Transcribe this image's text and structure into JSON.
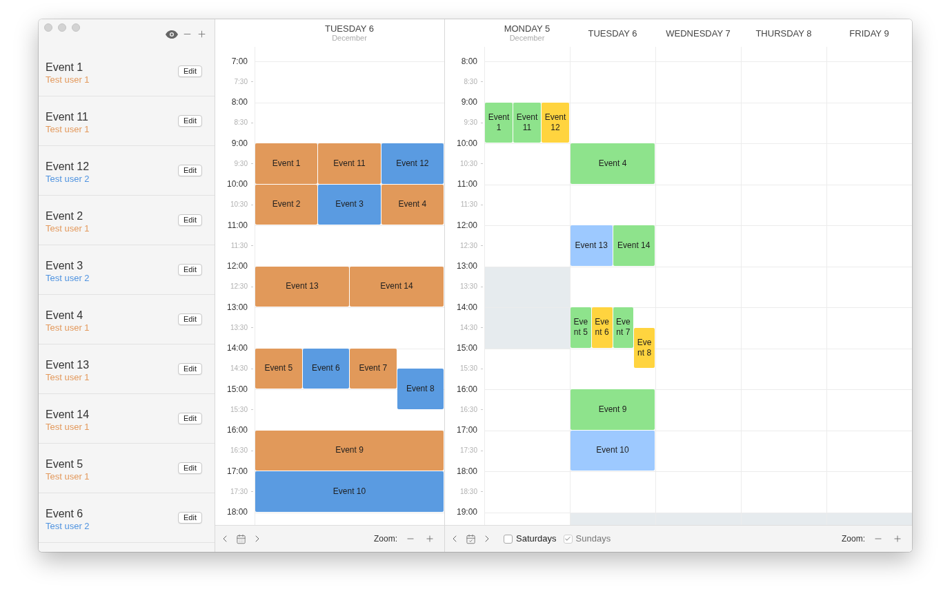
{
  "sidebar": {
    "items": [
      {
        "title": "Event 1",
        "user": "Test user 1",
        "color": "#e3995c",
        "button": "Edit"
      },
      {
        "title": "Event 11",
        "user": "Test user 1",
        "color": "#e3995c",
        "button": "Edit"
      },
      {
        "title": "Event 12",
        "user": "Test user 2",
        "color": "#4f93e0",
        "button": "Edit"
      },
      {
        "title": "Event 2",
        "user": "Test user 1",
        "color": "#e3995c",
        "button": "Edit"
      },
      {
        "title": "Event 3",
        "user": "Test user 2",
        "color": "#4f93e0",
        "button": "Edit"
      },
      {
        "title": "Event 4",
        "user": "Test user 1",
        "color": "#e3995c",
        "button": "Edit"
      },
      {
        "title": "Event 13",
        "user": "Test user 1",
        "color": "#e3995c",
        "button": "Edit"
      },
      {
        "title": "Event 14",
        "user": "Test user 1",
        "color": "#e3995c",
        "button": "Edit"
      },
      {
        "title": "Event 5",
        "user": "Test user 1",
        "color": "#e3995c",
        "button": "Edit"
      },
      {
        "title": "Event 6",
        "user": "Test user 2",
        "color": "#4f93e0",
        "button": "Edit"
      }
    ]
  },
  "day_view": {
    "title": "TUESDAY 6",
    "month": "December",
    "slots": [
      {
        "label": "7:00",
        "kind": "hour"
      },
      {
        "label": "7:30",
        "kind": "half"
      },
      {
        "label": "8:00",
        "kind": "hour"
      },
      {
        "label": "8:30",
        "kind": "half"
      },
      {
        "label": "9:00",
        "kind": "hour",
        "events": [
          {
            "title": "Event 1",
            "color": "#e1995a"
          },
          {
            "title": "Event 11",
            "color": "#e1995a"
          },
          {
            "title": "Event 12",
            "color": "#5a9be1"
          }
        ]
      },
      {
        "label": "9:30",
        "kind": "half"
      },
      {
        "label": "10:00",
        "kind": "hour",
        "events": [
          {
            "title": "Event 2",
            "color": "#e1995a"
          },
          {
            "title": "Event 3",
            "color": "#5a9be1"
          },
          {
            "title": "Event 4",
            "color": "#e1995a"
          }
        ]
      },
      {
        "label": "10:30",
        "kind": "half"
      },
      {
        "label": "11:00",
        "kind": "hour"
      },
      {
        "label": "11:30",
        "kind": "half"
      },
      {
        "label": "12:00",
        "kind": "hour",
        "events": [
          {
            "title": "Event 13",
            "color": "#e1995a"
          },
          {
            "title": "Event 14",
            "color": "#e1995a"
          }
        ]
      },
      {
        "label": "12:30",
        "kind": "half"
      },
      {
        "label": "13:00",
        "kind": "hour"
      },
      {
        "label": "13:30",
        "kind": "half"
      },
      {
        "label": "14:00",
        "kind": "hour",
        "events": [
          {
            "title": "Event 5",
            "color": "#e1995a"
          },
          {
            "title": "Event 6",
            "color": "#5a9be1"
          },
          {
            "title": "Event 7",
            "color": "#e1995a"
          }
        ]
      },
      {
        "label": "14:30",
        "kind": "half",
        "events": [
          {
            "title": "Event 8",
            "color": "#5a9be1"
          }
        ]
      },
      {
        "label": "15:00",
        "kind": "hour"
      },
      {
        "label": "15:30",
        "kind": "half"
      },
      {
        "label": "16:00",
        "kind": "hour",
        "events": [
          {
            "title": "Event 9",
            "color": "#e1995a"
          }
        ]
      },
      {
        "label": "16:30",
        "kind": "half"
      },
      {
        "label": "17:00",
        "kind": "hour",
        "events": [
          {
            "title": "Event 10",
            "color": "#5a9be1"
          }
        ]
      },
      {
        "label": "17:30",
        "kind": "half"
      },
      {
        "label": "18:00",
        "kind": "hour"
      }
    ],
    "toolbar": {
      "zoom_label": "Zoom:"
    }
  },
  "week_view": {
    "days": [
      {
        "title": "MONDAY 5",
        "month": "December"
      },
      {
        "title": "TUESDAY 6"
      },
      {
        "title": "WEDNESDAY 7"
      },
      {
        "title": "THURSDAY 8"
      },
      {
        "title": "FRIDAY 9"
      }
    ],
    "rows": [
      {
        "label": "8:00",
        "kind": "hour",
        "cells": [
          {
            "kind": "free"
          },
          {
            "kind": "free"
          },
          {
            "kind": "free"
          },
          {
            "kind": "free"
          },
          {
            "kind": "free"
          }
        ]
      },
      {
        "label": "8:30",
        "kind": "half",
        "cells": [
          {
            "kind": "free"
          },
          {
            "kind": "free"
          },
          {
            "kind": "free"
          },
          {
            "kind": "free"
          },
          {
            "kind": "free"
          }
        ]
      },
      {
        "label": "9:00",
        "kind": "hour",
        "cells": [
          {
            "kind": "free",
            "events": [
              {
                "title": "Event 1",
                "color": "#8ee38c"
              },
              {
                "title": "Event 11",
                "color": "#8ee38c"
              },
              {
                "title": "Event 12",
                "color": "#ffd43f"
              }
            ]
          },
          {
            "kind": "free"
          },
          {
            "kind": "free"
          },
          {
            "kind": "free"
          },
          {
            "kind": "free"
          }
        ]
      },
      {
        "label": "9:30",
        "kind": "half",
        "cells": [
          {
            "kind": "free"
          },
          {
            "kind": "free"
          },
          {
            "kind": "free"
          },
          {
            "kind": "free"
          },
          {
            "kind": "free"
          }
        ]
      },
      {
        "label": "10:00",
        "kind": "hour",
        "cells": [
          {
            "kind": "free"
          },
          {
            "kind": "free",
            "events": [
              {
                "title": "Event 4",
                "color": "#8ee38c"
              }
            ]
          },
          {
            "kind": "free"
          },
          {
            "kind": "free"
          },
          {
            "kind": "free"
          }
        ]
      },
      {
        "label": "10:30",
        "kind": "half",
        "cells": [
          {
            "kind": "free"
          },
          {
            "kind": "free"
          },
          {
            "kind": "free"
          },
          {
            "kind": "free"
          },
          {
            "kind": "free"
          }
        ]
      },
      {
        "label": "11:00",
        "kind": "hour",
        "cells": [
          {
            "kind": "free"
          },
          {
            "kind": "free"
          },
          {
            "kind": "free"
          },
          {
            "kind": "free"
          },
          {
            "kind": "free"
          }
        ]
      },
      {
        "label": "11:30",
        "kind": "half",
        "cells": [
          {
            "kind": "free"
          },
          {
            "kind": "free"
          },
          {
            "kind": "free"
          },
          {
            "kind": "free"
          },
          {
            "kind": "free"
          }
        ]
      },
      {
        "label": "12:00",
        "kind": "hour",
        "cells": [
          {
            "kind": "free"
          },
          {
            "kind": "free",
            "events": [
              {
                "title": "Event 13",
                "color": "#9dc9ff"
              },
              {
                "title": "Event 14",
                "color": "#8ee38c"
              }
            ]
          },
          {
            "kind": "free"
          },
          {
            "kind": "free"
          },
          {
            "kind": "free"
          }
        ]
      },
      {
        "label": "12:30",
        "kind": "half",
        "cells": [
          {
            "kind": "free"
          },
          {
            "kind": "free"
          },
          {
            "kind": "free"
          },
          {
            "kind": "free"
          },
          {
            "kind": "free"
          }
        ]
      },
      {
        "label": "13:00",
        "kind": "hour",
        "cells": [
          {
            "kind": "unavailable"
          },
          {
            "kind": "free"
          },
          {
            "kind": "free"
          },
          {
            "kind": "free"
          },
          {
            "kind": "free"
          }
        ]
      },
      {
        "label": "13:30",
        "kind": "half",
        "cells": [
          {
            "kind": "unavailable"
          },
          {
            "kind": "free"
          },
          {
            "kind": "free"
          },
          {
            "kind": "free"
          },
          {
            "kind": "free"
          }
        ]
      },
      {
        "label": "14:00",
        "kind": "hour",
        "cells": [
          {
            "kind": "unavailable"
          },
          {
            "kind": "free",
            "events": [
              {
                "title": "Event 5",
                "color": "#8ee38c"
              },
              {
                "title": "Event 6",
                "color": "#ffd43f"
              },
              {
                "title": "Event 7",
                "color": "#8ee38c"
              }
            ]
          },
          {
            "kind": "free"
          },
          {
            "kind": "free"
          },
          {
            "kind": "free"
          }
        ]
      },
      {
        "label": "14:30",
        "kind": "half",
        "cells": [
          {
            "kind": "unavailable"
          },
          {
            "kind": "free",
            "events": [
              {
                "title": "Event 8",
                "color": "#ffd43f"
              }
            ]
          },
          {
            "kind": "free"
          },
          {
            "kind": "free"
          },
          {
            "kind": "free"
          }
        ]
      },
      {
        "label": "15:00",
        "kind": "hour",
        "cells": [
          {
            "kind": "free"
          },
          {
            "kind": "free"
          },
          {
            "kind": "free"
          },
          {
            "kind": "free"
          },
          {
            "kind": "free"
          }
        ]
      },
      {
        "label": "15:30",
        "kind": "half",
        "cells": [
          {
            "kind": "free"
          },
          {
            "kind": "free"
          },
          {
            "kind": "free"
          },
          {
            "kind": "free"
          },
          {
            "kind": "free"
          }
        ]
      },
      {
        "label": "16:00",
        "kind": "hour",
        "cells": [
          {
            "kind": "free"
          },
          {
            "kind": "free",
            "events": [
              {
                "title": "Event 9",
                "color": "#8ee38c"
              }
            ]
          },
          {
            "kind": "free"
          },
          {
            "kind": "free"
          },
          {
            "kind": "free"
          }
        ]
      },
      {
        "label": "16:30",
        "kind": "half",
        "cells": [
          {
            "kind": "free"
          },
          {
            "kind": "free"
          },
          {
            "kind": "free"
          },
          {
            "kind": "free"
          },
          {
            "kind": "free"
          }
        ]
      },
      {
        "label": "17:00",
        "kind": "hour",
        "cells": [
          {
            "kind": "free"
          },
          {
            "kind": "free",
            "events": [
              {
                "title": "Event 10",
                "color": "#9dc9ff"
              }
            ]
          },
          {
            "kind": "free"
          },
          {
            "kind": "free"
          },
          {
            "kind": "free"
          }
        ]
      },
      {
        "label": "17:30",
        "kind": "half",
        "cells": [
          {
            "kind": "free"
          },
          {
            "kind": "free"
          },
          {
            "kind": "free"
          },
          {
            "kind": "free"
          },
          {
            "kind": "free"
          }
        ]
      },
      {
        "label": "18:00",
        "kind": "hour",
        "cells": [
          {
            "kind": "free"
          },
          {
            "kind": "free"
          },
          {
            "kind": "free"
          },
          {
            "kind": "free"
          },
          {
            "kind": "free"
          }
        ]
      },
      {
        "label": "18:30",
        "kind": "half",
        "cells": [
          {
            "kind": "free"
          },
          {
            "kind": "free"
          },
          {
            "kind": "free"
          },
          {
            "kind": "free"
          },
          {
            "kind": "free"
          }
        ]
      },
      {
        "label": "19:00",
        "kind": "hour",
        "cells": [
          {
            "kind": "free"
          },
          {
            "kind": "unavailable"
          },
          {
            "kind": "unavailable"
          },
          {
            "kind": "unavailable"
          },
          {
            "kind": "unavailable"
          }
        ]
      }
    ],
    "toolbar": {
      "checkboxes": [
        {
          "label": "Saturdays",
          "checked": false,
          "disabled": false
        },
        {
          "label": "Sundays",
          "checked": true,
          "disabled": true
        }
      ],
      "zoom_label": "Zoom:"
    }
  }
}
